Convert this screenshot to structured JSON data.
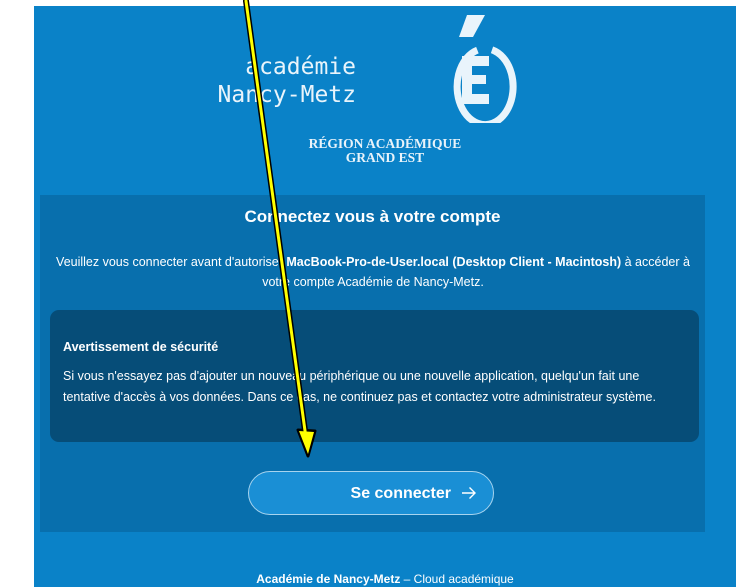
{
  "brand": {
    "logo_line1": "académie",
    "logo_line2": "Nancy-Metz",
    "region_line1": "RÉGION ACADÉMIQUE",
    "region_line2": "GRAND EST"
  },
  "card": {
    "title": "Connectez vous à votre compte",
    "intro_before": "Veuillez vous connecter avant d'autoriser ",
    "intro_client": "MacBook-Pro-de-User.local (Desktop Client - Macintosh)",
    "intro_after": " à accéder à votre compte Académie de Nancy-Metz."
  },
  "warning": {
    "title": "Avertissement de sécurité",
    "text": "Si vous n'essayez pas d'ajouter un nouveau périphérique ou une nouvelle application, quelqu'un fait une tentative d'accès à vos données. Dans ce cas, ne continuez pas et contactez votre administrateur système."
  },
  "button": {
    "label": "Se connecter",
    "icon": "arrow-right-icon"
  },
  "footer": {
    "name": "Académie de Nancy-Metz",
    "separator": " – ",
    "service": "Cloud académique"
  },
  "colors": {
    "background": "#0a82c8",
    "card": "#086fad",
    "warning_box": "#064d78",
    "annotation_arrow": "#ffff00"
  }
}
